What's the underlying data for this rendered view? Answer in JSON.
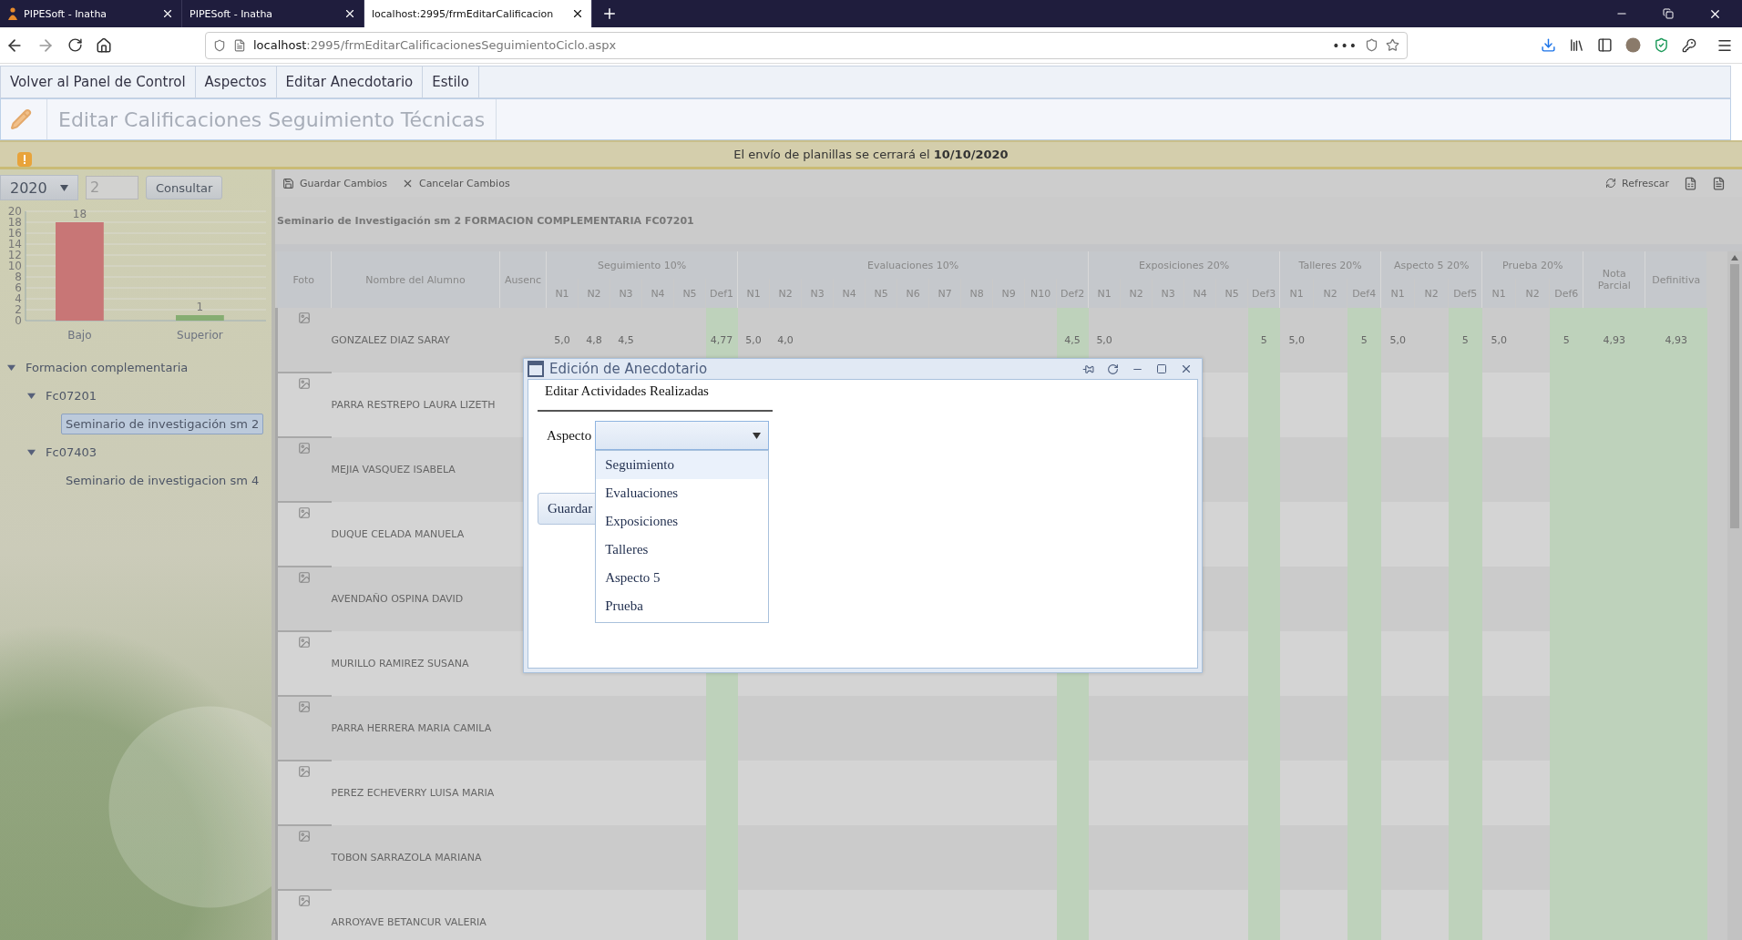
{
  "browser": {
    "tabs": [
      {
        "title": "PIPESoft - Inatha",
        "favicon": true,
        "selected": false
      },
      {
        "title": "PIPESoft - Inatha",
        "favicon": false,
        "selected": false
      },
      {
        "title": "localhost:2995/frmEditarCalificacion",
        "favicon": false,
        "selected": true
      }
    ],
    "more": "•••",
    "url_host": "localhost",
    "url_rest": ":2995/frmEditarCalificacionesSeguimientoCiclo.aspx"
  },
  "menu": [
    "Volver al Panel de Control",
    "Aspectos",
    "Editar Anecdotario",
    "Estilo"
  ],
  "page_title": "Editar Calificaciones Seguimiento Técnicas",
  "notice": "El envío de planillas se cerrará el **10/10/2020**",
  "filters": {
    "year": "2020",
    "period": "2",
    "button": "Consultar"
  },
  "chart_data": {
    "type": "bar",
    "grid": true,
    "data_labels": true,
    "ylim": [
      0,
      20
    ],
    "yticks": [
      0,
      2,
      4,
      6,
      8,
      10,
      12,
      14,
      16,
      18,
      20
    ],
    "series": [
      {
        "name": "Bajo",
        "color": "#c87676",
        "values": [
          18
        ]
      },
      {
        "name": "Superior",
        "color": "#86ad72",
        "values": [
          1
        ]
      }
    ]
  },
  "tree": [
    {
      "label": "Formacion complementaria",
      "expanded": true,
      "selected": false,
      "children": [
        {
          "label": "Fc07201",
          "expanded": true,
          "selected": false,
          "children": [
            {
              "label": "Seminario de investigación sm 2",
              "selected": true
            }
          ]
        },
        {
          "label": "Fc07403",
          "expanded": true,
          "selected": false,
          "children": [
            {
              "label": "Seminario de investigacion sm 4",
              "selected": false
            }
          ]
        }
      ]
    }
  ],
  "grid": {
    "toolbar": [
      {
        "label": "Guardar Cambios",
        "kind": "save"
      },
      {
        "label": "Cancelar Cambios",
        "kind": "cancel"
      }
    ],
    "refresh": "Refrescar",
    "title": "Seminario de Investigación sm 2 FORMACION COMPLEMENTARIA FC07201",
    "columns": [
      {
        "label": "Foto"
      },
      {
        "label": "Nombre del Alumno"
      },
      {
        "label": "Ausenc"
      },
      {
        "label": "Seguimiento 10%",
        "sub": [
          {
            "label": "N1",
            "kind": "note"
          },
          {
            "label": "N2",
            "kind": "note"
          },
          {
            "label": "N3",
            "kind": "note"
          },
          {
            "label": "N4",
            "kind": "note"
          },
          {
            "label": "N5",
            "kind": "note"
          },
          {
            "label": "Def1",
            "kind": "final"
          }
        ]
      },
      {
        "label": "Evaluaciones 10%",
        "sub": [
          {
            "label": "N1",
            "kind": "note"
          },
          {
            "label": "N2",
            "kind": "note"
          },
          {
            "label": "N3",
            "kind": "note"
          },
          {
            "label": "N4",
            "kind": "note"
          },
          {
            "label": "N5",
            "kind": "note"
          },
          {
            "label": "N6",
            "kind": "note"
          },
          {
            "label": "N7",
            "kind": "note"
          },
          {
            "label": "N8",
            "kind": "note"
          },
          {
            "label": "N9",
            "kind": "note"
          },
          {
            "label": "N10",
            "kind": "note"
          },
          {
            "label": "Def2",
            "kind": "final"
          }
        ]
      },
      {
        "label": "Exposiciones 20%",
        "sub": [
          {
            "label": "N1",
            "kind": "note"
          },
          {
            "label": "N2",
            "kind": "note"
          },
          {
            "label": "N3",
            "kind": "note"
          },
          {
            "label": "N4",
            "kind": "note"
          },
          {
            "label": "N5",
            "kind": "note"
          },
          {
            "label": "Def3",
            "kind": "final"
          }
        ]
      },
      {
        "label": "Talleres 20%",
        "sub": [
          {
            "label": "N1",
            "kind": "note"
          },
          {
            "label": "N2",
            "kind": "note"
          },
          {
            "label": "Def4",
            "kind": "final"
          }
        ]
      },
      {
        "label": "Aspecto 5 20%",
        "sub": [
          {
            "label": "N1",
            "kind": "note"
          },
          {
            "label": "N2",
            "kind": "note"
          },
          {
            "label": "Def5",
            "kind": "final"
          }
        ]
      },
      {
        "label": "Prueba 20%",
        "sub": [
          {
            "label": "N1",
            "kind": "note"
          },
          {
            "label": "N2",
            "kind": "note"
          },
          {
            "label": "Def6",
            "kind": "final"
          }
        ]
      },
      {
        "label": "Nota Parcial",
        "kind": "final"
      },
      {
        "label": "Definitiva",
        "kind": "final"
      }
    ],
    "rows": [
      {
        "name": "GONZALEZ DIAZ SARAY",
        "grades": [
          {
            "n1": "5,0",
            "n2": "4,8",
            "n3": "4,5",
            "def": "4,77"
          },
          {
            "n1": "5,0",
            "n2": "4,0",
            "def": "4,5"
          },
          {
            "n1": "5,0",
            "def": "5"
          },
          {
            "n1": "5,0",
            "def": "5"
          },
          {
            "n1": "5,0",
            "def": "5"
          },
          {
            "n1": "5,0",
            "def": "5"
          }
        ],
        "nota_parcial": "4,93",
        "definitiva": "4,93"
      },
      {
        "name": "PARRA RESTREPO LAURA LIZETH"
      },
      {
        "name": "MEJIA VASQUEZ ISABELA"
      },
      {
        "name": "DUQUE CELADA MANUELA"
      },
      {
        "name": "AVENDAÑO OSPINA DAVID"
      },
      {
        "name": "MURILLO RAMIREZ SUSANA"
      },
      {
        "name": "PARRA HERRERA MARIA CAMILA"
      },
      {
        "name": "PEREZ ECHEVERRY LUISA MARIA"
      },
      {
        "name": "TOBON SARRAZOLA MARIANA"
      },
      {
        "name": "ARROYAVE BETANCUR VALERIA"
      }
    ]
  },
  "dialog": {
    "title": "Edición de Anecdotario",
    "heading": "Editar Actividades Realizadas",
    "field_label": "Aspecto",
    "dropdown": {
      "expanded": true,
      "options": [
        {
          "label": "Seguimiento",
          "selected": true
        },
        {
          "label": "Evaluaciones",
          "selected": false
        },
        {
          "label": "Exposiciones",
          "selected": false
        },
        {
          "label": "Talleres",
          "selected": false
        },
        {
          "label": "Aspecto 5",
          "selected": false
        },
        {
          "label": "Prueba",
          "selected": false
        }
      ]
    },
    "button": "Guardar"
  }
}
